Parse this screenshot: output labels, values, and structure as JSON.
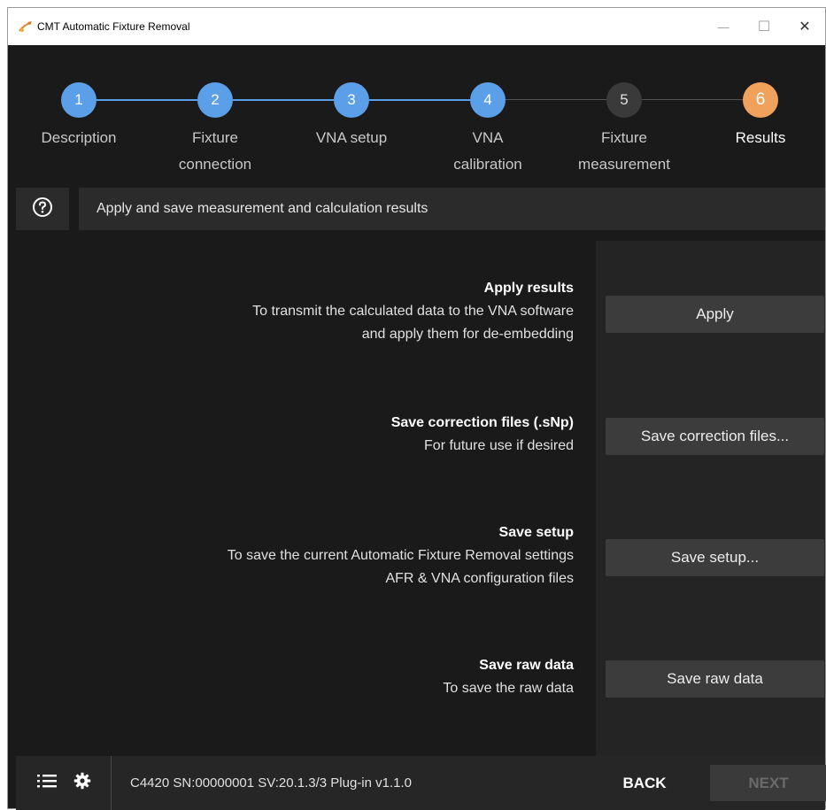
{
  "window": {
    "title": "CMT Automatic Fixture Removal",
    "minimize_glyph": "—",
    "maximize_glyph": "☐",
    "close_glyph": "✕"
  },
  "stepper": {
    "steps": [
      {
        "number": "1",
        "label_line1": "Description",
        "label_line2": "",
        "state": "completed"
      },
      {
        "number": "2",
        "label_line1": "Fixture",
        "label_line2": "connection",
        "state": "completed"
      },
      {
        "number": "3",
        "label_line1": "VNA setup",
        "label_line2": "",
        "state": "completed"
      },
      {
        "number": "4",
        "label_line1": "VNA",
        "label_line2": "calibration",
        "state": "completed"
      },
      {
        "number": "5",
        "label_line1": "Fixture",
        "label_line2": "measurement",
        "state": "pending"
      },
      {
        "number": "6",
        "label_line1": "Results",
        "label_line2": "",
        "state": "active"
      }
    ],
    "colors": {
      "completed": "#5b9fe8",
      "pending": "#3a3a3a",
      "active": "#f0a25c"
    }
  },
  "info": {
    "help_icon": "help-icon",
    "message": "Apply and save measurement and calculation results"
  },
  "sections": [
    {
      "heading": "Apply results",
      "line1": "To transmit the calculated data to the VNA software",
      "line2": "and apply them for de-embedding",
      "button": "Apply"
    },
    {
      "heading": "Save correction files (.sNp)",
      "line1": "For future use if desired",
      "line2": "",
      "button": "Save correction files..."
    },
    {
      "heading": "Save setup",
      "line1": "To save the current Automatic Fixture Removal settings",
      "line2": "AFR & VNA configuration files",
      "button": "Save setup..."
    },
    {
      "heading": "Save raw data",
      "line1": "To save the raw data",
      "line2": "",
      "button": "Save raw data"
    }
  ],
  "footer": {
    "menu_icon": "list-icon",
    "settings_icon": "gear-icon",
    "status": "C4420 SN:00000001 SV:20.1.3/3 Plug-in v1.1.0",
    "back_label": "BACK",
    "next_label": "NEXT"
  }
}
